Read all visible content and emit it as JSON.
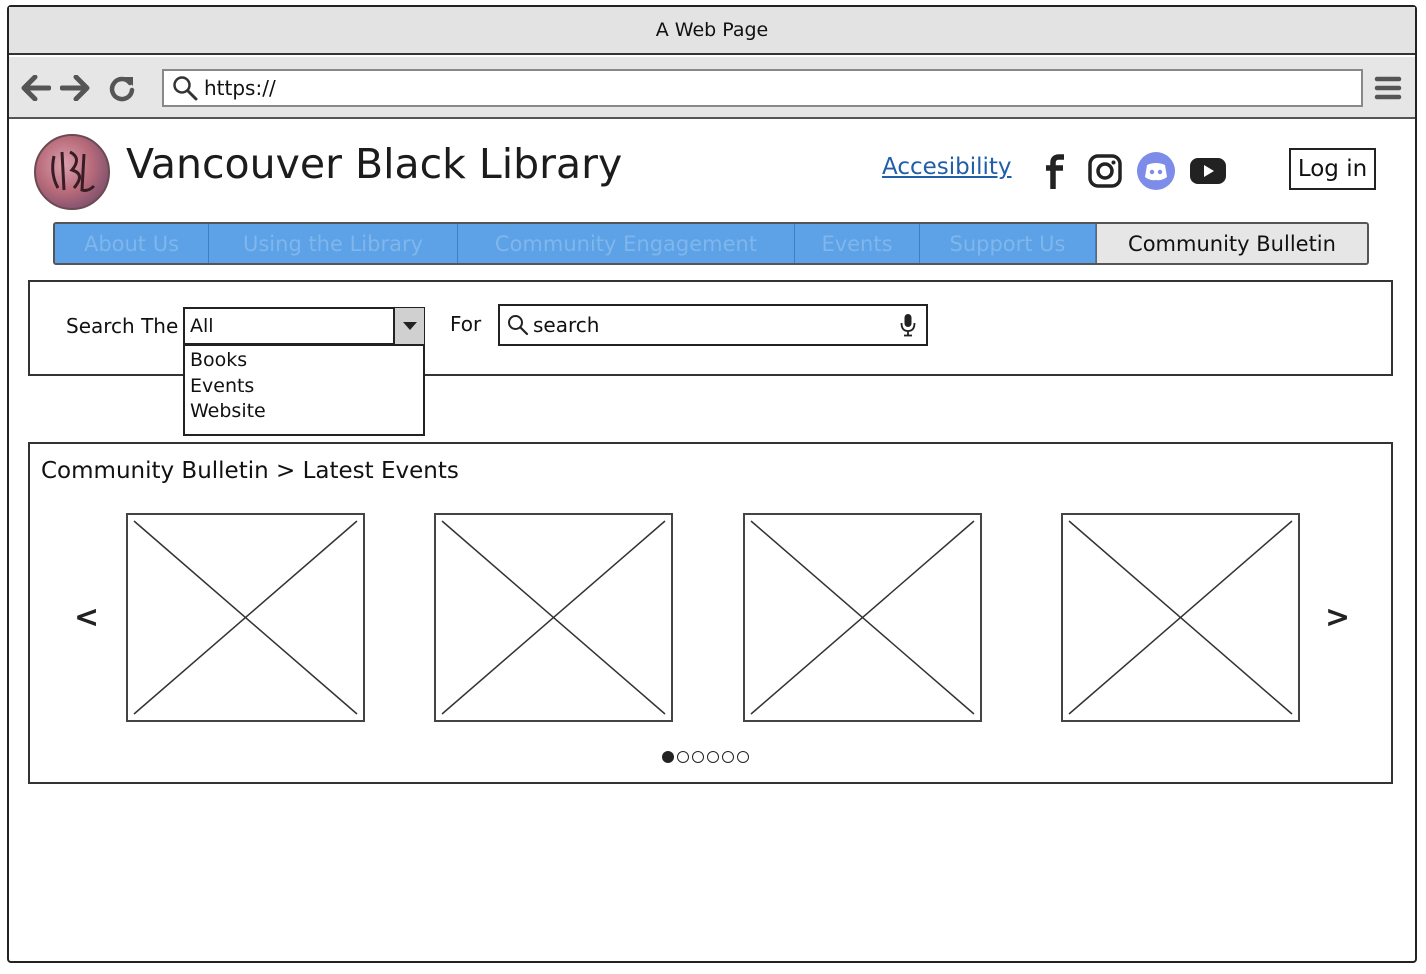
{
  "browser": {
    "title": "A Web Page",
    "url": "https://"
  },
  "site": {
    "title": "Vancouver Black Library",
    "accessibility_link": "Accesibility",
    "login_label": "Log in",
    "social_icons": [
      "facebook-icon",
      "instagram-icon",
      "discord-icon",
      "youtube-icon"
    ]
  },
  "nav": {
    "tabs": [
      {
        "label": "About Us",
        "active": false
      },
      {
        "label": "Using the Library",
        "active": false
      },
      {
        "label": "Community Engagement",
        "active": false
      },
      {
        "label": "Events",
        "active": false
      },
      {
        "label": "Support Us",
        "active": false
      },
      {
        "label": "Community Bulletin",
        "active": true
      }
    ],
    "colors": {
      "tab_bg": "#5da1e6",
      "active_bg": "#e6e6e6"
    }
  },
  "search": {
    "label": "Search The",
    "scope_value": "All",
    "options": [
      "Books",
      "Events",
      "Website"
    ],
    "for_label": "For",
    "placeholder": "search"
  },
  "bulletin": {
    "breadcrumb": "Community Bulletin > Latest Events",
    "prev_label": "<",
    "next_label": ">",
    "slides_visible": 4,
    "page_count": 6,
    "current_page": 1
  }
}
